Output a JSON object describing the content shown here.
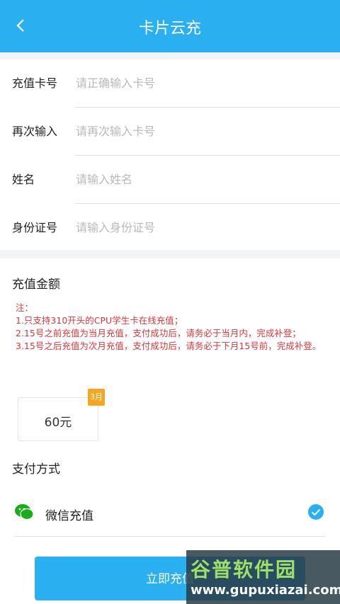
{
  "header": {
    "title": "卡片云充"
  },
  "form": {
    "rows": [
      {
        "label": "充值卡号",
        "placeholder": "请正确输入卡号"
      },
      {
        "label": "再次输入",
        "placeholder": "请再次输入卡号"
      },
      {
        "label": "姓名",
        "placeholder": "请输入姓名"
      },
      {
        "label": "身份证号",
        "placeholder": "请输入身份证号"
      }
    ]
  },
  "amount": {
    "title": "充值金额",
    "notes": [
      "注：",
      "1.只支持310开头的CPU学生卡在线充值；",
      "2.15号之前充值为当月充值，支付成功后，请务必于当月内，完成补登；",
      "3.15号之后充值为次月充值，支付成功后，请务必于下月15号前，完成补登。"
    ],
    "option_value": "60元",
    "option_badge": "3月"
  },
  "payment": {
    "title": "支付方式",
    "method_label": "微信充值",
    "method_icon": "wechat-icon",
    "selected": true
  },
  "submit_label": "立即充值",
  "watermark": {
    "line1": "谷普软件园",
    "line2": "www.gupuxiazai.com"
  },
  "colors": {
    "primary": "#2ab0f0",
    "note": "#d9373b",
    "badge": "#f5a623",
    "wechat": "#1aad19"
  }
}
